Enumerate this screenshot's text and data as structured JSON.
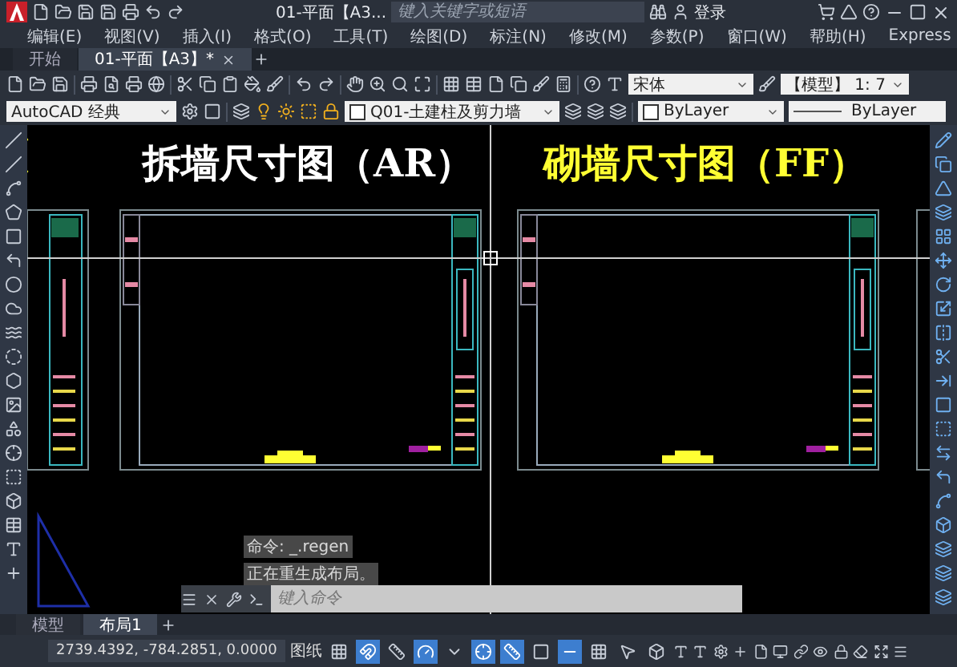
{
  "window": {
    "title": "01-平面【A3...",
    "search": {
      "placeholder": "键入关键字或短语"
    },
    "login": "登录"
  },
  "menu": [
    "编辑(E)",
    "视图(V)",
    "插入(I)",
    "格式(O)",
    "工具(T)",
    "绘图(D)",
    "标注(N)",
    "修改(M)",
    "参数(P)",
    "窗口(W)",
    "帮助(H)",
    "Express"
  ],
  "doc_tabs": [
    {
      "label": "开始",
      "selected": false
    },
    {
      "label": "01-平面【A3】*",
      "selected": true
    }
  ],
  "toolbar": {
    "font": "宋体",
    "scale": "【模型】 1: 7"
  },
  "properties": {
    "workspace": "AutoCAD 经典",
    "layer": "Q01-土建柱及剪力墙",
    "color_setting": "ByLayer",
    "linetype": "ByLayer"
  },
  "drawings": [
    {
      "title": "拆墙尺寸图（AR）",
      "color": "#ffffff"
    },
    {
      "title": "砌墙尺寸图（FF）",
      "color": "#ffff33"
    }
  ],
  "command": {
    "history": [
      "命令: _.regen",
      "正在重生成布局。"
    ],
    "placeholder": "键入命令"
  },
  "layout_tabs": [
    {
      "label": "模型",
      "selected": false
    },
    {
      "label": "布局1",
      "selected": true
    }
  ],
  "status_bar": {
    "coordinates": "2739.4392, -784.2851, 0.0000",
    "space": "图纸",
    "toggles": [
      {
        "on": false
      },
      {
        "on": true
      },
      {
        "on": false
      },
      {
        "on": true
      },
      {
        "on": false
      },
      {
        "on": true
      },
      {
        "on": true
      },
      {
        "on": false
      },
      {
        "on": true
      },
      {
        "on": false
      },
      {
        "on": false
      },
      {
        "on": false
      }
    ]
  }
}
